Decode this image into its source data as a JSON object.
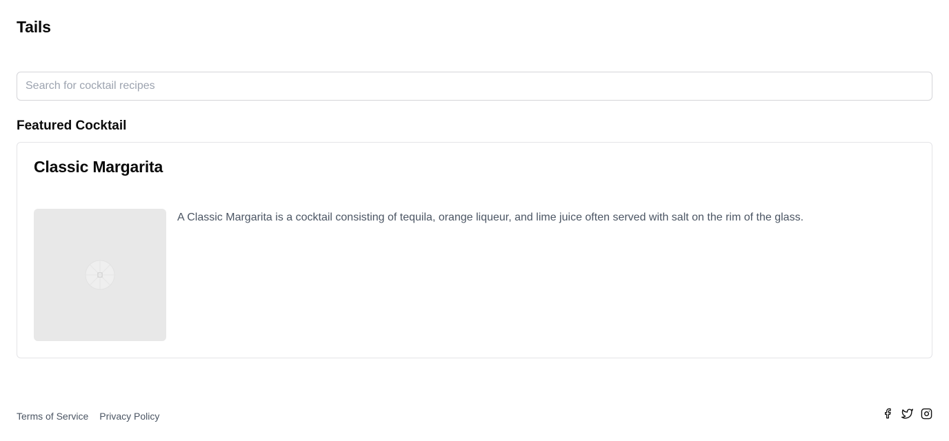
{
  "app": {
    "title": "Tails"
  },
  "search": {
    "placeholder": "Search for cocktail recipes",
    "value": ""
  },
  "featured": {
    "heading": "Featured Cocktail",
    "card": {
      "title": "Classic Margarita",
      "description": "A Classic Margarita is a cocktail consisting of tequila, orange liqueur, and lime juice often served with salt on the rim of the glass.",
      "image_icon": "image-placeholder-icon"
    }
  },
  "footer": {
    "links": [
      {
        "label": "Terms of Service"
      },
      {
        "label": "Privacy Policy"
      }
    ],
    "social": [
      {
        "icon": "facebook-icon"
      },
      {
        "icon": "twitter-icon"
      },
      {
        "icon": "instagram-icon"
      }
    ]
  },
  "colors": {
    "text_primary": "#0a0a0a",
    "text_muted": "#4b5563",
    "border": "#e4e4e7",
    "image_bg": "#e8e8e8",
    "placeholder": "#9ca3af"
  }
}
